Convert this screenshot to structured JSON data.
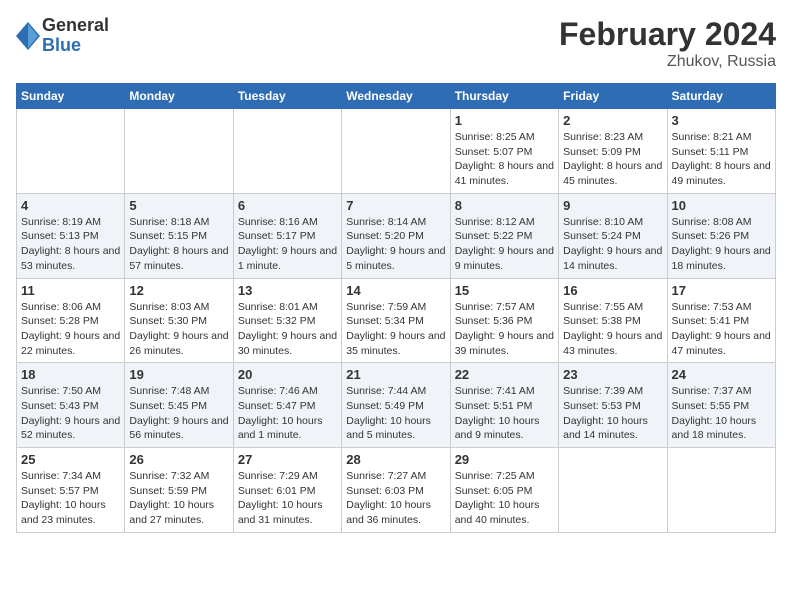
{
  "logo": {
    "general": "General",
    "blue": "Blue"
  },
  "title": {
    "month_year": "February 2024",
    "location": "Zhukov, Russia"
  },
  "days_of_week": [
    "Sunday",
    "Monday",
    "Tuesday",
    "Wednesday",
    "Thursday",
    "Friday",
    "Saturday"
  ],
  "weeks": [
    {
      "shaded": false,
      "days": [
        {
          "number": "",
          "info": ""
        },
        {
          "number": "",
          "info": ""
        },
        {
          "number": "",
          "info": ""
        },
        {
          "number": "",
          "info": ""
        },
        {
          "number": "1",
          "sunrise": "Sunrise: 8:25 AM",
          "sunset": "Sunset: 5:07 PM",
          "daylight": "Daylight: 8 hours and 41 minutes."
        },
        {
          "number": "2",
          "sunrise": "Sunrise: 8:23 AM",
          "sunset": "Sunset: 5:09 PM",
          "daylight": "Daylight: 8 hours and 45 minutes."
        },
        {
          "number": "3",
          "sunrise": "Sunrise: 8:21 AM",
          "sunset": "Sunset: 5:11 PM",
          "daylight": "Daylight: 8 hours and 49 minutes."
        }
      ]
    },
    {
      "shaded": true,
      "days": [
        {
          "number": "4",
          "sunrise": "Sunrise: 8:19 AM",
          "sunset": "Sunset: 5:13 PM",
          "daylight": "Daylight: 8 hours and 53 minutes."
        },
        {
          "number": "5",
          "sunrise": "Sunrise: 8:18 AM",
          "sunset": "Sunset: 5:15 PM",
          "daylight": "Daylight: 8 hours and 57 minutes."
        },
        {
          "number": "6",
          "sunrise": "Sunrise: 8:16 AM",
          "sunset": "Sunset: 5:17 PM",
          "daylight": "Daylight: 9 hours and 1 minute."
        },
        {
          "number": "7",
          "sunrise": "Sunrise: 8:14 AM",
          "sunset": "Sunset: 5:20 PM",
          "daylight": "Daylight: 9 hours and 5 minutes."
        },
        {
          "number": "8",
          "sunrise": "Sunrise: 8:12 AM",
          "sunset": "Sunset: 5:22 PM",
          "daylight": "Daylight: 9 hours and 9 minutes."
        },
        {
          "number": "9",
          "sunrise": "Sunrise: 8:10 AM",
          "sunset": "Sunset: 5:24 PM",
          "daylight": "Daylight: 9 hours and 14 minutes."
        },
        {
          "number": "10",
          "sunrise": "Sunrise: 8:08 AM",
          "sunset": "Sunset: 5:26 PM",
          "daylight": "Daylight: 9 hours and 18 minutes."
        }
      ]
    },
    {
      "shaded": false,
      "days": [
        {
          "number": "11",
          "sunrise": "Sunrise: 8:06 AM",
          "sunset": "Sunset: 5:28 PM",
          "daylight": "Daylight: 9 hours and 22 minutes."
        },
        {
          "number": "12",
          "sunrise": "Sunrise: 8:03 AM",
          "sunset": "Sunset: 5:30 PM",
          "daylight": "Daylight: 9 hours and 26 minutes."
        },
        {
          "number": "13",
          "sunrise": "Sunrise: 8:01 AM",
          "sunset": "Sunset: 5:32 PM",
          "daylight": "Daylight: 9 hours and 30 minutes."
        },
        {
          "number": "14",
          "sunrise": "Sunrise: 7:59 AM",
          "sunset": "Sunset: 5:34 PM",
          "daylight": "Daylight: 9 hours and 35 minutes."
        },
        {
          "number": "15",
          "sunrise": "Sunrise: 7:57 AM",
          "sunset": "Sunset: 5:36 PM",
          "daylight": "Daylight: 9 hours and 39 minutes."
        },
        {
          "number": "16",
          "sunrise": "Sunrise: 7:55 AM",
          "sunset": "Sunset: 5:38 PM",
          "daylight": "Daylight: 9 hours and 43 minutes."
        },
        {
          "number": "17",
          "sunrise": "Sunrise: 7:53 AM",
          "sunset": "Sunset: 5:41 PM",
          "daylight": "Daylight: 9 hours and 47 minutes."
        }
      ]
    },
    {
      "shaded": true,
      "days": [
        {
          "number": "18",
          "sunrise": "Sunrise: 7:50 AM",
          "sunset": "Sunset: 5:43 PM",
          "daylight": "Daylight: 9 hours and 52 minutes."
        },
        {
          "number": "19",
          "sunrise": "Sunrise: 7:48 AM",
          "sunset": "Sunset: 5:45 PM",
          "daylight": "Daylight: 9 hours and 56 minutes."
        },
        {
          "number": "20",
          "sunrise": "Sunrise: 7:46 AM",
          "sunset": "Sunset: 5:47 PM",
          "daylight": "Daylight: 10 hours and 1 minute."
        },
        {
          "number": "21",
          "sunrise": "Sunrise: 7:44 AM",
          "sunset": "Sunset: 5:49 PM",
          "daylight": "Daylight: 10 hours and 5 minutes."
        },
        {
          "number": "22",
          "sunrise": "Sunrise: 7:41 AM",
          "sunset": "Sunset: 5:51 PM",
          "daylight": "Daylight: 10 hours and 9 minutes."
        },
        {
          "number": "23",
          "sunrise": "Sunrise: 7:39 AM",
          "sunset": "Sunset: 5:53 PM",
          "daylight": "Daylight: 10 hours and 14 minutes."
        },
        {
          "number": "24",
          "sunrise": "Sunrise: 7:37 AM",
          "sunset": "Sunset: 5:55 PM",
          "daylight": "Daylight: 10 hours and 18 minutes."
        }
      ]
    },
    {
      "shaded": false,
      "days": [
        {
          "number": "25",
          "sunrise": "Sunrise: 7:34 AM",
          "sunset": "Sunset: 5:57 PM",
          "daylight": "Daylight: 10 hours and 23 minutes."
        },
        {
          "number": "26",
          "sunrise": "Sunrise: 7:32 AM",
          "sunset": "Sunset: 5:59 PM",
          "daylight": "Daylight: 10 hours and 27 minutes."
        },
        {
          "number": "27",
          "sunrise": "Sunrise: 7:29 AM",
          "sunset": "Sunset: 6:01 PM",
          "daylight": "Daylight: 10 hours and 31 minutes."
        },
        {
          "number": "28",
          "sunrise": "Sunrise: 7:27 AM",
          "sunset": "Sunset: 6:03 PM",
          "daylight": "Daylight: 10 hours and 36 minutes."
        },
        {
          "number": "29",
          "sunrise": "Sunrise: 7:25 AM",
          "sunset": "Sunset: 6:05 PM",
          "daylight": "Daylight: 10 hours and 40 minutes."
        },
        {
          "number": "",
          "info": ""
        },
        {
          "number": "",
          "info": ""
        }
      ]
    }
  ]
}
